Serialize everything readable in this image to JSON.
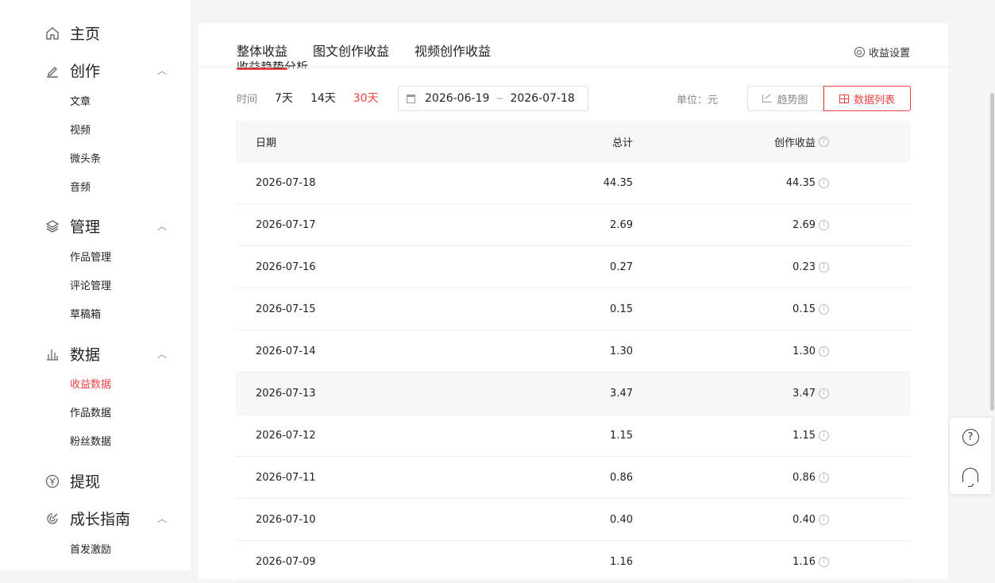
{
  "sidebar": {
    "home": "主页",
    "create": {
      "label": "创作",
      "items": [
        "文章",
        "视频",
        "微头条",
        "音频"
      ]
    },
    "manage": {
      "label": "管理",
      "items": [
        "作品管理",
        "评论管理",
        "草稿箱"
      ]
    },
    "data": {
      "label": "数据",
      "items": [
        "收益数据",
        "作品数据",
        "粉丝数据"
      ],
      "active": "收益数据"
    },
    "withdraw": "提现",
    "growth": {
      "label": "成长指南",
      "items": [
        "首发激励"
      ]
    }
  },
  "tabs": [
    "整体收益",
    "图文创作收益",
    "视频创作收益"
  ],
  "settings_label": "收益设置",
  "section_title": "收益趋势分析",
  "filter": {
    "time_label": "时间",
    "options": [
      "7天",
      "14天",
      "30天"
    ],
    "active": "30天",
    "date_start": "2026-06-19",
    "date_sep": "~",
    "date_end": "2026-07-18"
  },
  "unit_label": "单位：元",
  "view": {
    "trend": "趋势图",
    "list": "数据列表"
  },
  "table": {
    "headers": [
      "日期",
      "总计",
      "创作收益"
    ],
    "rows": [
      {
        "date": "2026-07-18",
        "total": "44.35",
        "income": "44.35"
      },
      {
        "date": "2026-07-17",
        "total": "2.69",
        "income": "2.69"
      },
      {
        "date": "2026-07-16",
        "total": "0.27",
        "income": "0.23"
      },
      {
        "date": "2026-07-15",
        "total": "0.15",
        "income": "0.15"
      },
      {
        "date": "2026-07-14",
        "total": "1.30",
        "income": "1.30"
      },
      {
        "date": "2026-07-13",
        "total": "3.47",
        "income": "3.47"
      },
      {
        "date": "2026-07-12",
        "total": "1.15",
        "income": "1.15"
      },
      {
        "date": "2026-07-11",
        "total": "0.86",
        "income": "0.86"
      },
      {
        "date": "2026-07-10",
        "total": "0.40",
        "income": "0.40"
      },
      {
        "date": "2026-07-09",
        "total": "1.16",
        "income": "1.16"
      }
    ]
  },
  "colors": {
    "accent": "#f04142"
  }
}
